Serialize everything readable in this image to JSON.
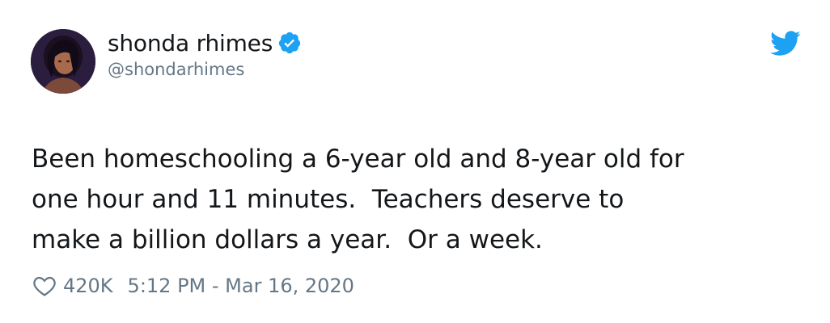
{
  "author": {
    "display_name": "shonda rhimes",
    "handle": "@shondarhimes",
    "verified": true
  },
  "tweet": {
    "text": "Been homeschooling a 6-year old and 8-year old for\none hour and 11 minutes.  Teachers deserve to\nmake a billion dollars a year.  Or a week."
  },
  "footer": {
    "like_count": "420K",
    "timestamp": "5:12 PM - Mar 16, 2020"
  },
  "icons": {
    "verified": "verified-badge-icon",
    "platform": "twitter-bird-icon",
    "like": "heart-outline-icon"
  },
  "colors": {
    "twitter_blue": "#1da1f2",
    "text_primary": "#14171a",
    "text_secondary": "#657786"
  }
}
